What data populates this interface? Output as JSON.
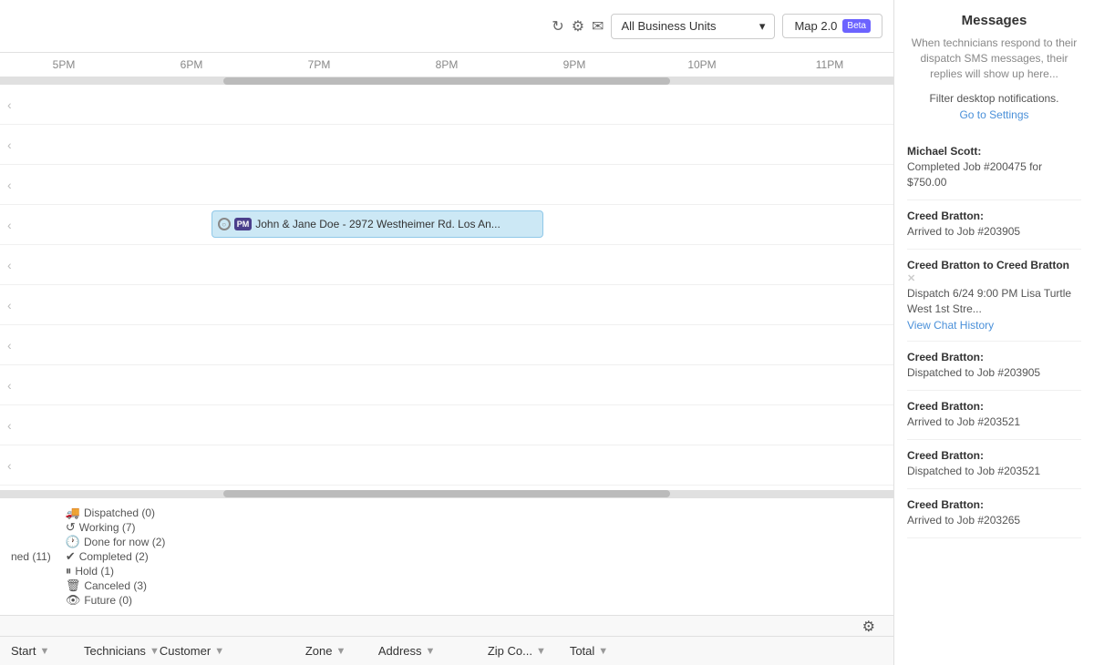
{
  "topbar": {
    "business_unit_placeholder": "All Business Units",
    "business_unit_dropdown_arrow": "▾",
    "map_label": "Map 2.0",
    "beta_label": "Beta"
  },
  "timeline": {
    "times": [
      "5PM",
      "6PM",
      "7PM",
      "8PM",
      "9PM",
      "10PM",
      "11PM"
    ]
  },
  "rows": [
    {
      "has_job": false
    },
    {
      "has_job": false
    },
    {
      "has_job": false
    },
    {
      "has_job": true,
      "job_text": "John & Jane Doe - 2972 Westheimer Rd. Los An...",
      "job_avatar": "PM",
      "job_left": "22%",
      "job_width": "38%"
    },
    {
      "has_job": false
    },
    {
      "has_job": false
    },
    {
      "has_job": false
    },
    {
      "has_job": false
    },
    {
      "has_job": false
    },
    {
      "has_job": false
    }
  ],
  "status_bar": {
    "items": [
      {
        "icon": "truck",
        "label": "Dispatched",
        "count": 0,
        "unicode": "🚚"
      },
      {
        "icon": "working",
        "label": "Working",
        "count": 7,
        "unicode": "↺"
      },
      {
        "icon": "done",
        "label": "Done for now",
        "count": 2,
        "unicode": "🕐"
      },
      {
        "icon": "completed",
        "label": "Completed",
        "count": 2,
        "unicode": "✔"
      },
      {
        "icon": "hold",
        "label": "Hold",
        "count": 1,
        "unicode": "⏸"
      },
      {
        "icon": "canceled",
        "label": "Canceled",
        "count": 3,
        "unicode": "🗑"
      },
      {
        "icon": "future",
        "label": "Future",
        "count": 0,
        "unicode": "👁"
      }
    ],
    "scheduled_label": "ned (11)"
  },
  "table_header": {
    "cols": [
      {
        "key": "start",
        "label": "Start"
      },
      {
        "key": "technicians",
        "label": "Technicians"
      },
      {
        "key": "customer",
        "label": "Customer"
      },
      {
        "key": "zone",
        "label": "Zone"
      },
      {
        "key": "address",
        "label": "Address"
      },
      {
        "key": "zip",
        "label": "Zip Co..."
      },
      {
        "key": "total",
        "label": "Total"
      }
    ]
  },
  "messages_panel": {
    "title": "Messages",
    "subtitle": "When technicians respond to their dispatch SMS messages, their replies will show up here...",
    "filter_text": "Filter desktop notifications.",
    "settings_link": "Go to Settings",
    "messages": [
      {
        "sender": "Michael Scott:",
        "text": "Completed Job #200475 for $750.00",
        "link": null
      },
      {
        "sender": "Creed Bratton:",
        "text": "Arrived to Job #203905",
        "link": null
      },
      {
        "sender": "Creed Bratton",
        "to": "Creed Bratton",
        "text": "Dispatch 6/24 9:00 PM Lisa Turtle West 1st Stre...",
        "link": "View Chat History"
      },
      {
        "sender": "Creed Bratton:",
        "text": "Dispatched to Job #203905",
        "link": null
      },
      {
        "sender": "Creed Bratton:",
        "text": "Arrived to Job #203521",
        "link": null
      },
      {
        "sender": "Creed Bratton:",
        "text": "Dispatched to Job #203521",
        "link": null
      },
      {
        "sender": "Creed Bratton:",
        "text": "Arrived to Job #203265",
        "link": null
      }
    ]
  }
}
